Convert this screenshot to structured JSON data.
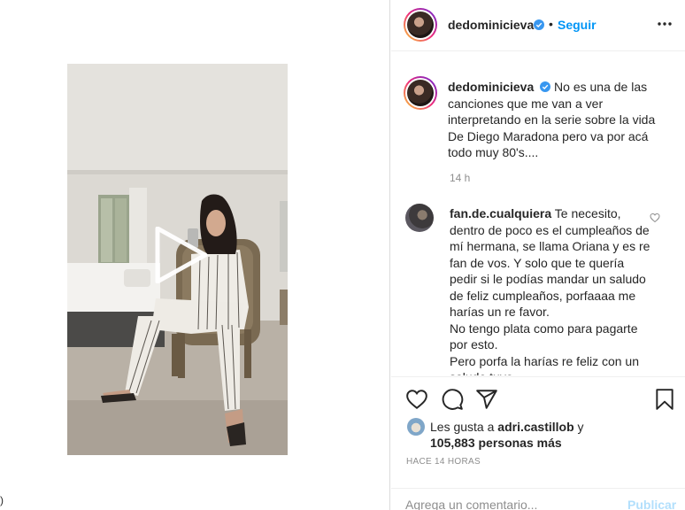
{
  "post": {
    "author": "dedominicieva",
    "follow_label": "Seguir",
    "separator": "•",
    "caption_author": "dedominicieva",
    "caption": "No es una de las canciones que me van a ver interpretando en la serie sobre la vida De Diego Maradona pero va por acá todo muy 80's....",
    "caption_time": "14 h"
  },
  "comment": {
    "author": "fan.de.cualquiera",
    "text_lines": [
      "Te necesito, dentro de poco es el cumpleaños de mí hermana, se llama Oriana y es re fan de vos. Y solo que te quería pedir si le podías mandar un saludo de feliz cumpleaños, porfaaaa me harías un re favor.",
      "No tengo plata como para pagarte por esto.",
      "Pero porfa la harías re feliz con un saludo tuyo"
    ]
  },
  "likes": {
    "prefix": "Les gusta a",
    "user": "adri.castillob",
    "conj": "y",
    "count": "105,883 personas más"
  },
  "time_ago": "HACE 14 HORAS",
  "comment_box": {
    "placeholder": "Agrega un comentario...",
    "publish_label": "Publicar"
  },
  "left_edge_text": ")",
  "icons": {
    "like": "heart-icon",
    "comment": "comment-bubble-icon",
    "share": "paper-plane-icon",
    "save": "bookmark-icon",
    "more": "more-dots-icon",
    "verified": "verified-badge-icon",
    "play": "play-icon"
  },
  "colors": {
    "link_blue": "#0095f6",
    "publish_disabled": "#b2dffc",
    "verified": "#3897f0",
    "muted": "#8e8e8e"
  }
}
